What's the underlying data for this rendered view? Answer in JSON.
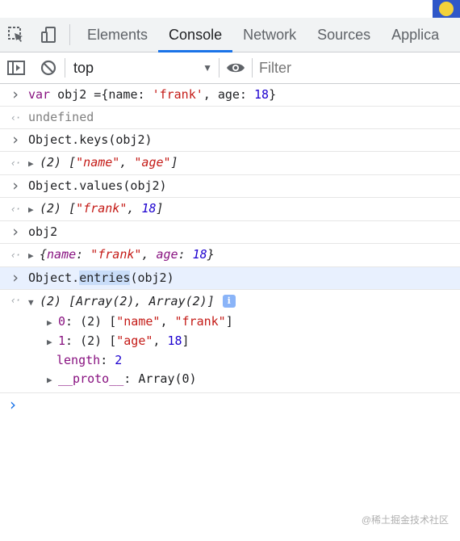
{
  "tabs": [
    {
      "label": "Elements"
    },
    {
      "label": "Console"
    },
    {
      "label": "Network"
    },
    {
      "label": "Sources"
    },
    {
      "label": "Applica"
    }
  ],
  "toolbar": {
    "context": "top",
    "filter_placeholder": "Filter"
  },
  "console": {
    "cmd1": {
      "prefix": "var",
      "name": "obj2",
      "eq": "=",
      "open": "{name: ",
      "str": "'frank'",
      "mid": ", age: ",
      "num": "18",
      "close": "}"
    },
    "res1": "undefined",
    "cmd2": "Object.keys(obj2)",
    "res2": {
      "count": "(2)",
      "open": "[",
      "a": "\"name\"",
      "sep": ", ",
      "b": "\"age\"",
      "close": "]"
    },
    "cmd3": "Object.values(obj2)",
    "res3": {
      "count": "(2)",
      "open": "[",
      "a": "\"frank\"",
      "sep": ", ",
      "b": "18",
      "close": "]"
    },
    "cmd4": "obj2",
    "res4": {
      "open": "{",
      "k1": "name",
      "colon1": ": ",
      "v1": "\"frank\"",
      "sep": ", ",
      "k2": "age",
      "colon2": ": ",
      "v2": "18",
      "close": "}"
    },
    "cmd5": {
      "before": "Object.",
      "word": "entries",
      "after": "(obj2)"
    },
    "res5": {
      "summary": "(2) [Array(2), Array(2)]",
      "info_glyph": "i",
      "item0": {
        "key": "0",
        "count": "(2)",
        "open": "[",
        "a": "\"name\"",
        "sep": ", ",
        "b": "\"frank\"",
        "close": "]"
      },
      "item1": {
        "key": "1",
        "count": "(2)",
        "open": "[",
        "a": "\"age\"",
        "sep": ", ",
        "b": "18",
        "close": "]"
      },
      "length_key": "length",
      "length_val": "2",
      "proto_key": "__proto__",
      "proto_val": "Array(0)"
    }
  },
  "watermark": "@稀土掘金技术社区"
}
